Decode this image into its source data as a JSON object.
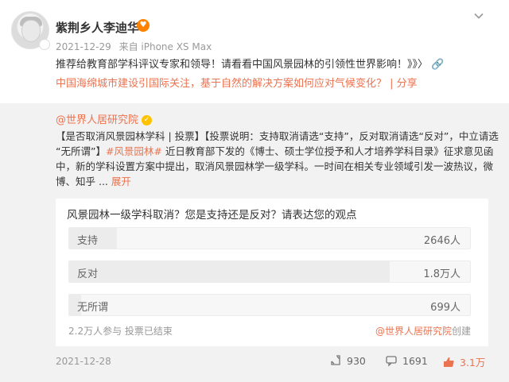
{
  "post": {
    "user_name": "紫荆乡人李迪华",
    "vip_icon": "vip-heart-icon",
    "date": "2021-12-29",
    "source": "来自 iPhone XS Max",
    "text": "推荐给教育部学科评议专家和领导！请看看中国风景园林的引领性世界影响！》》〉",
    "link_text": "中国海绵城市建设引国际关注，基于自然的解决方案如何应对气候变化？ | 分享",
    "accent_color": "#eb7350"
  },
  "repost": {
    "author": "@世界人居研究院",
    "text_line1": "【是否取消风景园林学科 | 投票】【投票说明：支持取消请选“支持”，反对取消请选“反对”，中立请选",
    "text_line2_pre": "“无所谓”】",
    "hashtag": "#风景园林#",
    "text_line2_post": " 近日教育部下发的《博士、硕士学位授予和人才培养学科目录》征求意见函",
    "text_line3": "中，新的学科设置方案中提出，取消风景园林学一级学科。一时间在相关专业领域引发一波热议，微",
    "text_line4_pre": "博、知乎 ... ",
    "expand_label": "展开"
  },
  "poll": {
    "question": "风景园林一级学科取消？您是支持还是反对？请表达您的观点",
    "options": [
      {
        "label": "支持",
        "count": "2646人",
        "share": 0.12
      },
      {
        "label": "反对",
        "count": "1.8万人",
        "share": 0.8
      },
      {
        "label": "无所谓",
        "count": "699人",
        "share": 0.03
      }
    ],
    "summary": "2.2万人参与  投票已结束",
    "creator": "@世界人居研究院",
    "creator_suffix": "创建"
  },
  "footer": {
    "date": "2021-12-28",
    "repost_count": "930",
    "comment_count": "1691",
    "like_count": "3.1万"
  }
}
